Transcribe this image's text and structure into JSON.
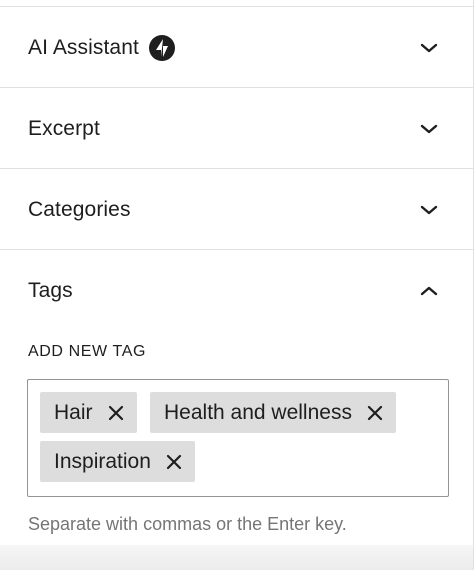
{
  "panels": [
    {
      "title": "AI Assistant",
      "icon": "jetpack-bolt-icon",
      "expanded": false
    },
    {
      "title": "Excerpt",
      "expanded": false
    },
    {
      "title": "Categories",
      "expanded": false
    },
    {
      "title": "Tags",
      "expanded": true
    }
  ],
  "tags": {
    "field_label": "ADD NEW TAG",
    "tokens": [
      "Hair",
      "Health and wellness",
      "Inspiration"
    ],
    "help_text": "Separate with commas or the Enter key."
  }
}
